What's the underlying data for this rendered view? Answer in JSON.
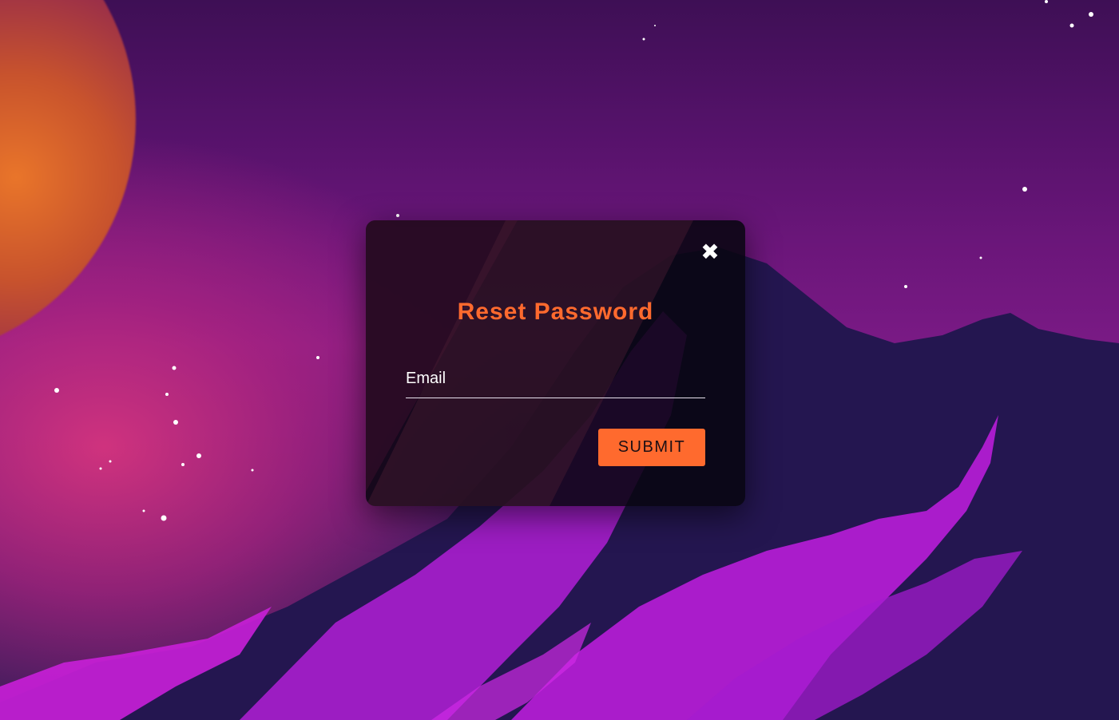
{
  "modal": {
    "close_icon": "✖",
    "title": "Reset Password",
    "email_placeholder": "Email",
    "submit_label": "SUBMIT"
  },
  "colors": {
    "accent": "#ff6a2e",
    "modal_bg": "#0b0812",
    "text": "#ffffff"
  },
  "background": {
    "scene": "night sky with planet and purple mountains"
  }
}
